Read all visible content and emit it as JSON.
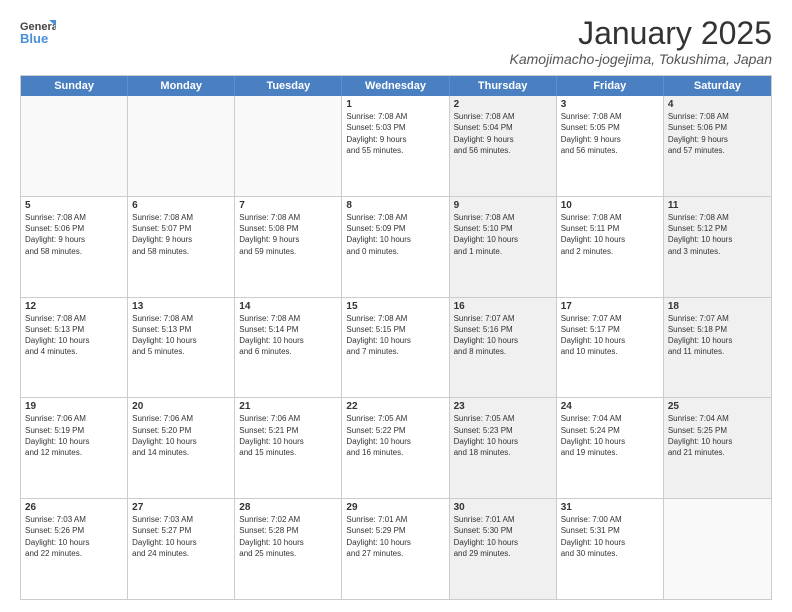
{
  "header": {
    "logo_general": "General",
    "logo_blue": "Blue",
    "title": "January 2025",
    "subtitle": "Kamojimacho-jogejima, Tokushima, Japan"
  },
  "weekdays": [
    "Sunday",
    "Monday",
    "Tuesday",
    "Wednesday",
    "Thursday",
    "Friday",
    "Saturday"
  ],
  "weeks": [
    [
      {
        "day": "",
        "info": "",
        "empty": true
      },
      {
        "day": "",
        "info": "",
        "empty": true
      },
      {
        "day": "",
        "info": "",
        "empty": true
      },
      {
        "day": "1",
        "info": "Sunrise: 7:08 AM\nSunset: 5:03 PM\nDaylight: 9 hours\nand 55 minutes.",
        "shaded": false
      },
      {
        "day": "2",
        "info": "Sunrise: 7:08 AM\nSunset: 5:04 PM\nDaylight: 9 hours\nand 56 minutes.",
        "shaded": true
      },
      {
        "day": "3",
        "info": "Sunrise: 7:08 AM\nSunset: 5:05 PM\nDaylight: 9 hours\nand 56 minutes.",
        "shaded": false
      },
      {
        "day": "4",
        "info": "Sunrise: 7:08 AM\nSunset: 5:06 PM\nDaylight: 9 hours\nand 57 minutes.",
        "shaded": true
      }
    ],
    [
      {
        "day": "5",
        "info": "Sunrise: 7:08 AM\nSunset: 5:06 PM\nDaylight: 9 hours\nand 58 minutes.",
        "shaded": false
      },
      {
        "day": "6",
        "info": "Sunrise: 7:08 AM\nSunset: 5:07 PM\nDaylight: 9 hours\nand 58 minutes.",
        "shaded": false
      },
      {
        "day": "7",
        "info": "Sunrise: 7:08 AM\nSunset: 5:08 PM\nDaylight: 9 hours\nand 59 minutes.",
        "shaded": false
      },
      {
        "day": "8",
        "info": "Sunrise: 7:08 AM\nSunset: 5:09 PM\nDaylight: 10 hours\nand 0 minutes.",
        "shaded": false
      },
      {
        "day": "9",
        "info": "Sunrise: 7:08 AM\nSunset: 5:10 PM\nDaylight: 10 hours\nand 1 minute.",
        "shaded": true
      },
      {
        "day": "10",
        "info": "Sunrise: 7:08 AM\nSunset: 5:11 PM\nDaylight: 10 hours\nand 2 minutes.",
        "shaded": false
      },
      {
        "day": "11",
        "info": "Sunrise: 7:08 AM\nSunset: 5:12 PM\nDaylight: 10 hours\nand 3 minutes.",
        "shaded": true
      }
    ],
    [
      {
        "day": "12",
        "info": "Sunrise: 7:08 AM\nSunset: 5:13 PM\nDaylight: 10 hours\nand 4 minutes.",
        "shaded": false
      },
      {
        "day": "13",
        "info": "Sunrise: 7:08 AM\nSunset: 5:13 PM\nDaylight: 10 hours\nand 5 minutes.",
        "shaded": false
      },
      {
        "day": "14",
        "info": "Sunrise: 7:08 AM\nSunset: 5:14 PM\nDaylight: 10 hours\nand 6 minutes.",
        "shaded": false
      },
      {
        "day": "15",
        "info": "Sunrise: 7:08 AM\nSunset: 5:15 PM\nDaylight: 10 hours\nand 7 minutes.",
        "shaded": false
      },
      {
        "day": "16",
        "info": "Sunrise: 7:07 AM\nSunset: 5:16 PM\nDaylight: 10 hours\nand 8 minutes.",
        "shaded": true
      },
      {
        "day": "17",
        "info": "Sunrise: 7:07 AM\nSunset: 5:17 PM\nDaylight: 10 hours\nand 10 minutes.",
        "shaded": false
      },
      {
        "day": "18",
        "info": "Sunrise: 7:07 AM\nSunset: 5:18 PM\nDaylight: 10 hours\nand 11 minutes.",
        "shaded": true
      }
    ],
    [
      {
        "day": "19",
        "info": "Sunrise: 7:06 AM\nSunset: 5:19 PM\nDaylight: 10 hours\nand 12 minutes.",
        "shaded": false
      },
      {
        "day": "20",
        "info": "Sunrise: 7:06 AM\nSunset: 5:20 PM\nDaylight: 10 hours\nand 14 minutes.",
        "shaded": false
      },
      {
        "day": "21",
        "info": "Sunrise: 7:06 AM\nSunset: 5:21 PM\nDaylight: 10 hours\nand 15 minutes.",
        "shaded": false
      },
      {
        "day": "22",
        "info": "Sunrise: 7:05 AM\nSunset: 5:22 PM\nDaylight: 10 hours\nand 16 minutes.",
        "shaded": false
      },
      {
        "day": "23",
        "info": "Sunrise: 7:05 AM\nSunset: 5:23 PM\nDaylight: 10 hours\nand 18 minutes.",
        "shaded": true
      },
      {
        "day": "24",
        "info": "Sunrise: 7:04 AM\nSunset: 5:24 PM\nDaylight: 10 hours\nand 19 minutes.",
        "shaded": false
      },
      {
        "day": "25",
        "info": "Sunrise: 7:04 AM\nSunset: 5:25 PM\nDaylight: 10 hours\nand 21 minutes.",
        "shaded": true
      }
    ],
    [
      {
        "day": "26",
        "info": "Sunrise: 7:03 AM\nSunset: 5:26 PM\nDaylight: 10 hours\nand 22 minutes.",
        "shaded": false
      },
      {
        "day": "27",
        "info": "Sunrise: 7:03 AM\nSunset: 5:27 PM\nDaylight: 10 hours\nand 24 minutes.",
        "shaded": false
      },
      {
        "day": "28",
        "info": "Sunrise: 7:02 AM\nSunset: 5:28 PM\nDaylight: 10 hours\nand 25 minutes.",
        "shaded": false
      },
      {
        "day": "29",
        "info": "Sunrise: 7:01 AM\nSunset: 5:29 PM\nDaylight: 10 hours\nand 27 minutes.",
        "shaded": false
      },
      {
        "day": "30",
        "info": "Sunrise: 7:01 AM\nSunset: 5:30 PM\nDaylight: 10 hours\nand 29 minutes.",
        "shaded": true
      },
      {
        "day": "31",
        "info": "Sunrise: 7:00 AM\nSunset: 5:31 PM\nDaylight: 10 hours\nand 30 minutes.",
        "shaded": false
      },
      {
        "day": "",
        "info": "",
        "empty": true
      }
    ]
  ]
}
